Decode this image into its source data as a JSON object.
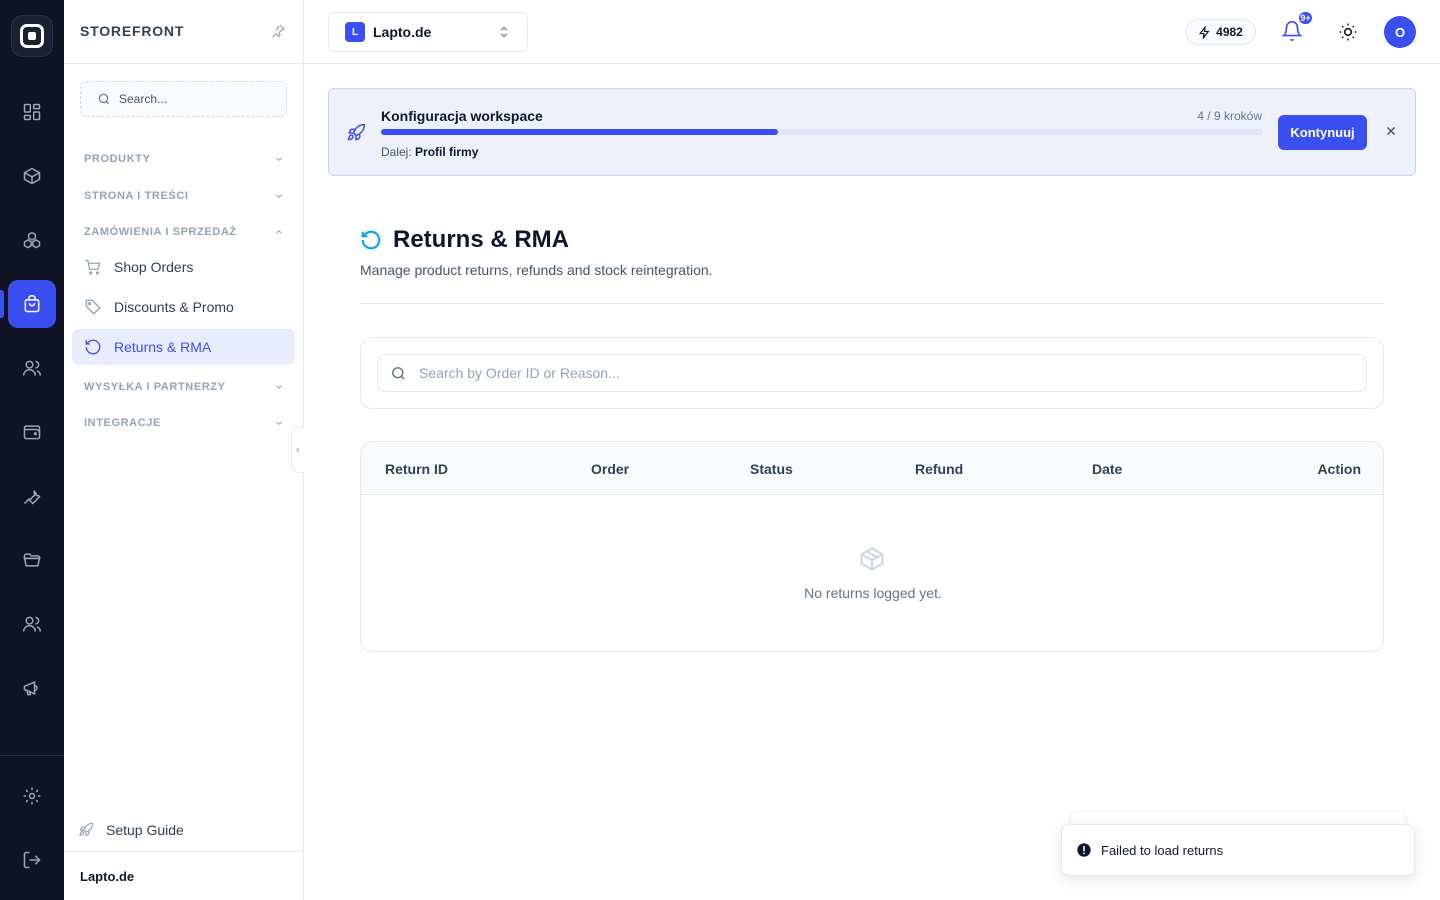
{
  "rail": {
    "items": [
      "dashboard-icon",
      "box-icon",
      "modules-icon",
      "shopping-bag-icon",
      "users-icon",
      "wallet-icon",
      "wrench-icon",
      "folder-icon",
      "team-icon",
      "megaphone-icon"
    ],
    "active": "shopping-bag-icon",
    "bottom": [
      "settings-icon",
      "logout-icon"
    ]
  },
  "sidebar": {
    "title": "STOREFRONT",
    "search_placeholder": "Search...",
    "sections": {
      "produkty": "PRODUKTY",
      "strona": "STRONA I TREŚCI",
      "zamowienia": "ZAMÓWIENIA I SPRZEDAŻ",
      "wysylka": "WYSYŁKA I PARTNERZY",
      "integracje": "INTEGRACJE"
    },
    "items": {
      "shop_orders": "Shop Orders",
      "discounts": "Discounts & Promo",
      "returns": "Returns & RMA"
    },
    "setup_guide": "Setup Guide",
    "footer": "Lapto.de"
  },
  "topbar": {
    "workspace_badge": "L",
    "workspace_name": "Lapto.de",
    "credits": "4982",
    "notifications_badge": "9+",
    "avatar_initial": "O"
  },
  "banner": {
    "title": "Konfiguracja workspace",
    "steps": "4 / 9 kroków",
    "progress": 0.45,
    "next_label": "Dalej:",
    "next_value": "Profil firmy",
    "button": "Kontynuuj"
  },
  "page": {
    "title": "Returns & RMA",
    "subtitle": "Manage product returns, refunds and stock reintegration.",
    "search_placeholder": "Search by Order ID or Reason..."
  },
  "table": {
    "columns": [
      "Return ID",
      "Order",
      "Status",
      "Refund",
      "Date",
      "Action"
    ],
    "empty": "No returns logged yet."
  },
  "toast": {
    "message": "Failed to load returns"
  },
  "colors": {
    "accent": "#3b4ff0",
    "rail_bg": "#0f1324",
    "page_icon": "#0ea5e9"
  }
}
